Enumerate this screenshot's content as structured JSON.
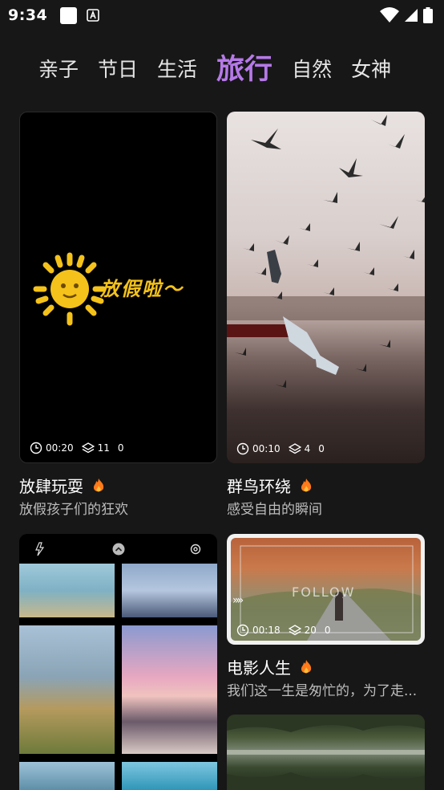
{
  "status": {
    "time": "9:34"
  },
  "tabs": [
    {
      "label": "亲子"
    },
    {
      "label": "节日"
    },
    {
      "label": "生活"
    },
    {
      "label": "旅行"
    },
    {
      "label": "自然"
    },
    {
      "label": "女神"
    }
  ],
  "active_tab": "旅行",
  "cards": [
    {
      "overlay_text": "放假啦～",
      "duration": "00:20",
      "layers": "11",
      "count": "0",
      "title": "放肆玩耍",
      "subtitle": "放假孩子们的狂欢"
    },
    {
      "duration": "00:10",
      "layers": "4",
      "count": "0",
      "title": "群鸟环绕",
      "subtitle": "感受自由的瞬间"
    },
    {
      "overlay_text": "FOLLOW",
      "duration": "00:18",
      "layers": "20",
      "count": "0",
      "title": "电影人生",
      "subtitle": "我们这一生是匆忙的，为了走..."
    }
  ],
  "colors": {
    "background": "#171717",
    "accent": "#b679e8",
    "subtitle": "#bdbdbd"
  }
}
